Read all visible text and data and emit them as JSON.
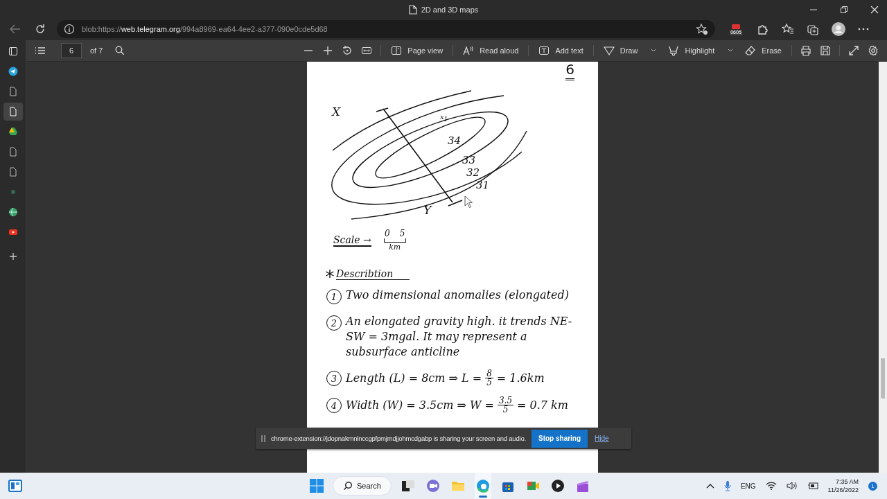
{
  "window": {
    "title": "2D and 3D maps"
  },
  "address_bar": {
    "scheme": "blob:https://",
    "host": "web.telegram.org",
    "path": "/994a8969-ea64-4ee2-a377-090e0cde5d68"
  },
  "extension_badge": "0605",
  "pdf_toolbar": {
    "page": "6",
    "page_total": "of 7",
    "tools": [
      {
        "kind": "zoom-out"
      },
      {
        "kind": "zoom-in"
      },
      {
        "kind": "rotate"
      },
      {
        "kind": "fit"
      },
      {
        "kind": "page-view",
        "label": "Page view",
        "dropdown": false
      },
      {
        "kind": "read-aloud",
        "label": "Read aloud",
        "dropdown": false
      },
      {
        "kind": "add-text",
        "label": "Add text",
        "dropdown": false
      },
      {
        "kind": "draw",
        "label": "Draw",
        "dropdown": true
      },
      {
        "kind": "highlight",
        "label": "Highlight",
        "dropdown": true
      },
      {
        "kind": "erase",
        "label": "Erase",
        "dropdown": false
      },
      {
        "kind": "print"
      },
      {
        "kind": "save"
      },
      {
        "kind": "fullscreen"
      },
      {
        "kind": "settings"
      }
    ]
  },
  "sidebar": {
    "items": [
      {
        "kind": "tab-actions",
        "selected": false
      },
      {
        "kind": "telegram",
        "selected": false
      },
      {
        "kind": "doc",
        "selected": false
      },
      {
        "kind": "doc",
        "selected": true
      },
      {
        "kind": "drive",
        "selected": false
      },
      {
        "kind": "doc",
        "selected": false
      },
      {
        "kind": "doc",
        "selected": false
      },
      {
        "kind": "dot",
        "selected": false
      },
      {
        "kind": "globe",
        "selected": false
      },
      {
        "kind": "video",
        "selected": false
      },
      {
        "kind": "add",
        "selected": false
      }
    ]
  },
  "document": {
    "page_number": "6",
    "map_labels": [
      {
        "kind": "axis",
        "text": "X"
      },
      {
        "kind": "axis",
        "text": "Y"
      },
      {
        "kind": "mark",
        "text": "x$_{1}$"
      },
      {
        "kind": "contour",
        "text": "34"
      },
      {
        "kind": "contour",
        "text": "33"
      },
      {
        "kind": "contour",
        "text": "32"
      },
      {
        "kind": "contour",
        "text": "31"
      }
    ],
    "scale": {
      "label": "Scale →",
      "start": "0",
      "end": "5",
      "unit": "km"
    },
    "heading": "Describtion",
    "items": [
      {
        "number": "1",
        "kind": "text",
        "text": "Two dimensional anomalies (elongated)"
      },
      {
        "number": "2",
        "kind": "text",
        "text": "An elongated gravity high. it trends NE-SW = 3mgal. It may represent a subsurface anticline"
      },
      {
        "number": "3",
        "kind": "formula",
        "text": "Length (L) = 8cm ⇒ L =",
        "numerator": "8",
        "denominator": "5",
        "result": "= 1.6km"
      },
      {
        "number": "4",
        "kind": "formula",
        "text": "Width (W) = 3.5cm ⇒ W =",
        "numerator": "3.5",
        "denominator": "5",
        "result": "= 0.7 km"
      }
    ]
  },
  "share_bar": {
    "message": "chrome-extension://jdopnakmnlnccgpfpmjmdjjohmcdgabp is sharing your screen and audio.",
    "stop": "Stop sharing",
    "hide": "Hide"
  },
  "taskbar": {
    "search": "Search",
    "apps": [
      {
        "kind": "tasks",
        "active": false
      },
      {
        "kind": "chat",
        "active": false
      },
      {
        "kind": "folder",
        "active": false
      },
      {
        "kind": "edge",
        "active": true
      },
      {
        "kind": "store",
        "active": false
      },
      {
        "kind": "meet",
        "active": false
      },
      {
        "kind": "player",
        "active": false
      },
      {
        "kind": "clapper",
        "active": false
      }
    ],
    "language": "ENG",
    "time": "7:35 AM",
    "date": "11/26/2022",
    "notifications": "1"
  }
}
